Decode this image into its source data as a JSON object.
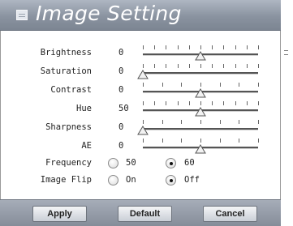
{
  "dialog": {
    "title": "Image Setting",
    "title_icon": "window-icon"
  },
  "settings": [
    {
      "label": "Brightness",
      "value": "0",
      "min": -5,
      "max": 5,
      "position": 0.5,
      "ticks": 11
    },
    {
      "label": "Saturation",
      "value": "0",
      "min": 0,
      "max": 10,
      "position": 0.0,
      "ticks": 11
    },
    {
      "label": "Contrast",
      "value": "0",
      "min": -3,
      "max": 3,
      "position": 0.5,
      "ticks": 7
    },
    {
      "label": "Hue",
      "value": "50",
      "min": 0,
      "max": 100,
      "position": 0.5,
      "ticks": 11
    },
    {
      "label": "Sharpness",
      "value": "0",
      "min": 0,
      "max": 6,
      "position": 0.0,
      "ticks": 7
    },
    {
      "label": "AE",
      "value": "0",
      "min": -3,
      "max": 3,
      "position": 0.5,
      "ticks": 7
    }
  ],
  "frequency": {
    "label": "Frequency",
    "options": [
      "50",
      "60"
    ],
    "selected": "60"
  },
  "image_flip": {
    "label": "Image Flip",
    "options": [
      "On",
      "Off"
    ],
    "selected": "Off"
  },
  "buttons": {
    "apply": "Apply",
    "default": "Default",
    "cancel": "Cancel"
  },
  "colors": {
    "titlebar": "#8a93a0",
    "footer": "#959ca7",
    "thumb_fill": "#f2f2f2",
    "thumb_stroke": "#555555"
  }
}
